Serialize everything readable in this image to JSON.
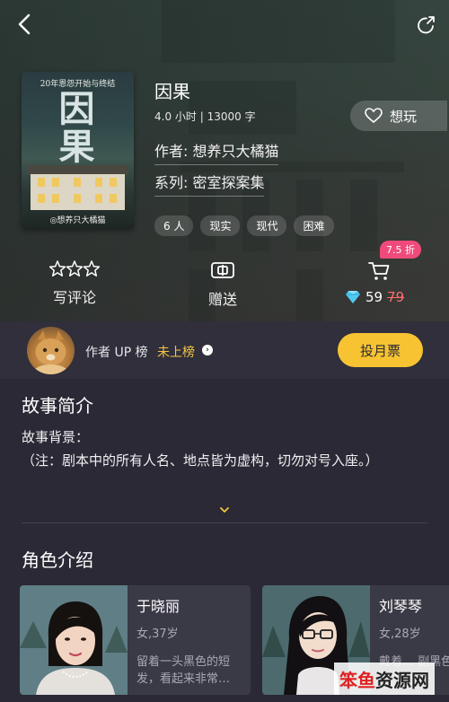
{
  "book": {
    "title": "因果",
    "meta": "4.0 小时 | 13000 字",
    "author": "作者: 想养只大橘猫",
    "series": "系列: 密室探案集",
    "tags": [
      "6 人",
      "现实",
      "现代",
      "困难"
    ],
    "cover": {
      "subtitle": "20年恩怨开始与终结",
      "title_line1": "因",
      "title_line2": "果",
      "author": "◎想养只大橘猫"
    }
  },
  "want_button": {
    "label": "想玩",
    "icon": "heart-outline-icon"
  },
  "actions": {
    "review": {
      "label": "写评论",
      "icon": "three-stars-outline-icon"
    },
    "gift": {
      "label": "赠送",
      "icon": "gift-card-icon"
    },
    "buy": {
      "discount": "7.5 折",
      "price": "59",
      "original_price": "79",
      "icon": "cart-icon",
      "currency_icon": "diamond-icon"
    }
  },
  "rank": {
    "label": "作者 UP 榜",
    "status": "未上榜",
    "button": "投月票"
  },
  "story": {
    "title": "故事简介",
    "lines": [
      "故事背景：",
      "（注：剧本中的所有人名、地点皆为虚构，切勿对号入座。）"
    ]
  },
  "characters": {
    "title": "角色介绍",
    "items": [
      {
        "name": "于晓丽",
        "age": "女,37岁",
        "desc": "留着一头黑色的短发，看起来非常…"
      },
      {
        "name": "刘琴琴",
        "age": "女,28岁",
        "desc": "戴着… 副黑色…"
      }
    ]
  },
  "watermark": {
    "part1": "笨鱼",
    "part2": "资源网"
  },
  "colors": {
    "accent_yellow": "#f7c332",
    "badge_pink": "#ef4b7a",
    "rank_gold": "#f5c542",
    "bg_dark": "#2a2935"
  }
}
